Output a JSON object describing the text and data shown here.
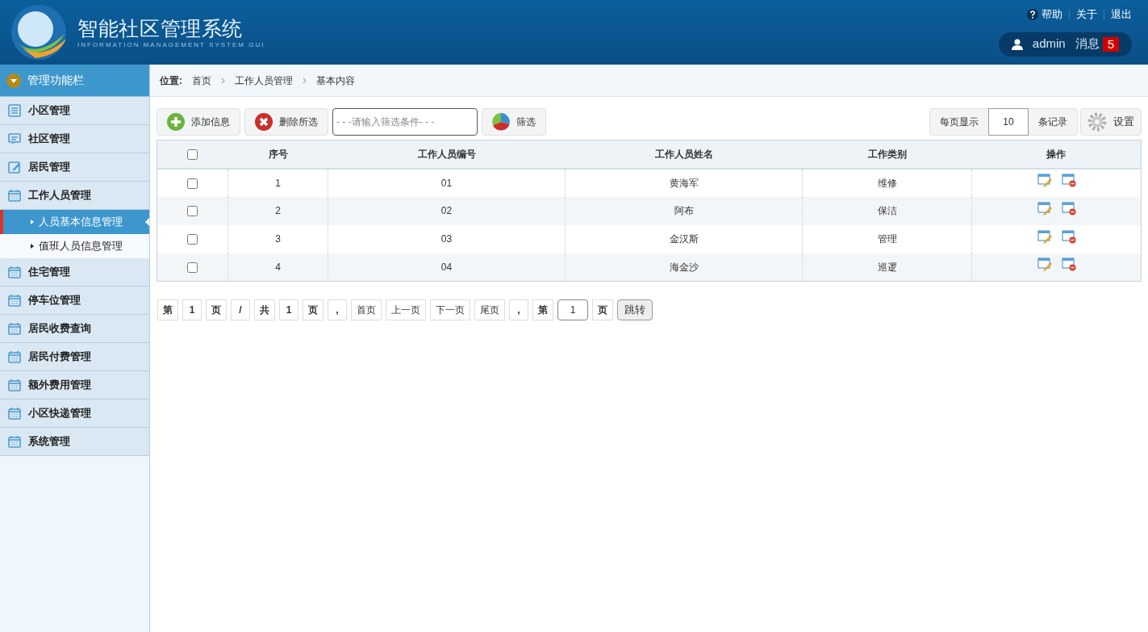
{
  "header": {
    "title": "智能社区管理系统",
    "subtitle": "INFORMATION MANAGEMENT SYSTEM GUI",
    "links": [
      "帮助",
      "关于",
      "退出"
    ],
    "user": "admin",
    "messages_label": "消息",
    "messages_count": "5"
  },
  "sidebar": {
    "title": "管理功能栏",
    "items": [
      {
        "label": "小区管理",
        "kind": "list"
      },
      {
        "label": "社区管理",
        "kind": "comment"
      },
      {
        "label": "居民管理",
        "kind": "edit"
      },
      {
        "label": "工作人员管理",
        "kind": "calendar",
        "children": [
          {
            "label": "人员基本信息管理",
            "selected": true
          },
          {
            "label": "值班人员信息管理",
            "selected": false
          }
        ]
      },
      {
        "label": "住宅管理",
        "kind": "calendar"
      },
      {
        "label": "停车位管理",
        "kind": "calendar"
      },
      {
        "label": "居民收费查询",
        "kind": "calendar"
      },
      {
        "label": "居民付费管理",
        "kind": "calendar"
      },
      {
        "label": "额外费用管理",
        "kind": "calendar"
      },
      {
        "label": "小区快递管理",
        "kind": "calendar"
      },
      {
        "label": "系统管理",
        "kind": "calendar"
      }
    ]
  },
  "breadcrumb": {
    "label": "位置:",
    "path": [
      "首页",
      "工作人员管理",
      "基本内容"
    ]
  },
  "toolbar": {
    "add": "添加信息",
    "delete": "删除所选",
    "filter_placeholder": "- - -请输入筛选条件- - -",
    "filter": "筛选",
    "per_page_label": "每页显示",
    "per_page": "10",
    "records_label": "条记录",
    "settings": "设置"
  },
  "table": {
    "columns": [
      "序号",
      "工作人员编号",
      "工作人员姓名",
      "工作类别",
      "操作"
    ],
    "all_checked": false,
    "rows": [
      {
        "checked": false,
        "cells": [
          "1",
          "01",
          "黄海军",
          "维修"
        ]
      },
      {
        "checked": false,
        "cells": [
          "2",
          "02",
          "阿布",
          "保洁"
        ]
      },
      {
        "checked": false,
        "cells": [
          "3",
          "03",
          "金汉斯",
          "管理"
        ]
      },
      {
        "checked": false,
        "cells": [
          "4",
          "04",
          "海金沙",
          "巡逻"
        ]
      }
    ]
  },
  "pagination": [
    {
      "kind": "text",
      "label": "第"
    },
    {
      "kind": "text",
      "label": "1"
    },
    {
      "kind": "text",
      "label": "页"
    },
    {
      "kind": "text",
      "label": "/"
    },
    {
      "kind": "text",
      "label": "共"
    },
    {
      "kind": "text",
      "label": "1"
    },
    {
      "kind": "text",
      "label": "页"
    },
    {
      "kind": "text",
      "label": ","
    },
    {
      "kind": "link",
      "label": "首页"
    },
    {
      "kind": "link",
      "label": "上一页"
    },
    {
      "kind": "link",
      "label": "下一页"
    },
    {
      "kind": "link",
      "label": "尾页"
    },
    {
      "kind": "text",
      "label": ","
    },
    {
      "kind": "text",
      "label": "第"
    },
    {
      "kind": "input",
      "label": "1"
    },
    {
      "kind": "text",
      "label": "页"
    },
    {
      "kind": "button",
      "label": "跳转"
    }
  ]
}
